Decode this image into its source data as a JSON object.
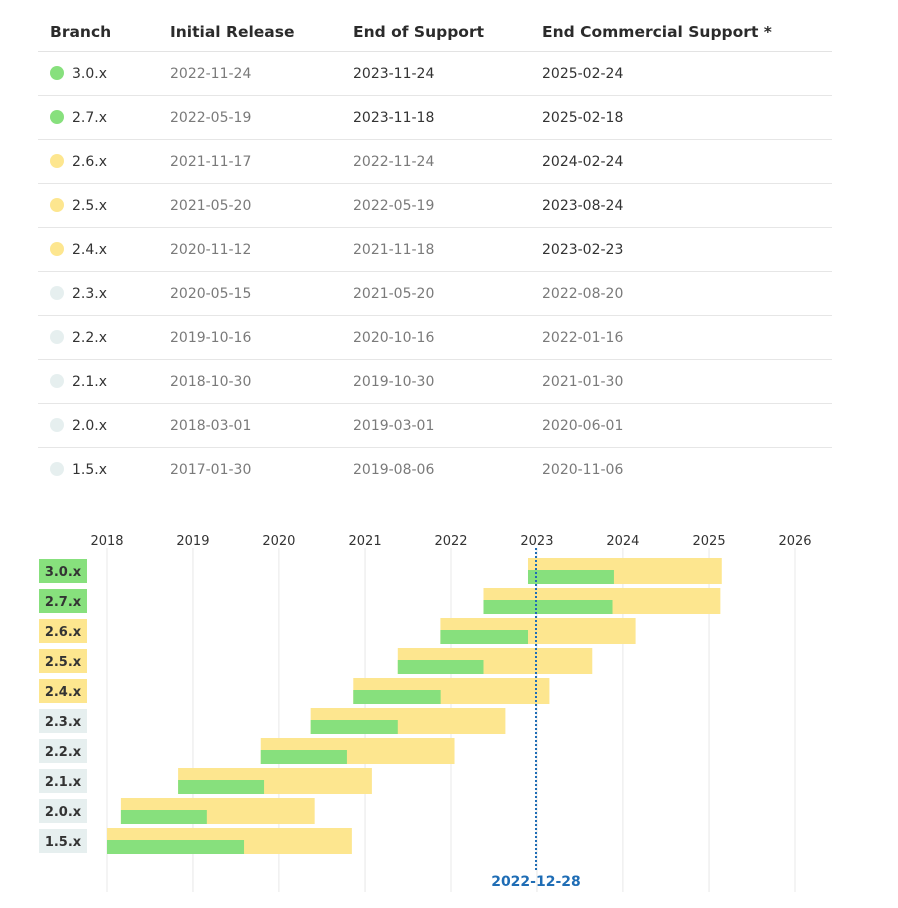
{
  "colors": {
    "supported": "#87e07d",
    "security": "#fde68f",
    "eol": "#e6efef",
    "now_line": "#1f6db5",
    "grid": "#e8e8e8"
  },
  "table": {
    "headers": [
      "Branch",
      "Initial Release",
      "End of Support",
      "End Commercial Support *"
    ],
    "rows": [
      {
        "branch": "3.0.x",
        "status": "supported",
        "initial": "2022-11-24",
        "eos": "2023-11-24",
        "ecs": "2025-02-24"
      },
      {
        "branch": "2.7.x",
        "status": "supported",
        "initial": "2022-05-19",
        "eos": "2023-11-18",
        "ecs": "2025-02-18"
      },
      {
        "branch": "2.6.x",
        "status": "security",
        "initial": "2021-11-17",
        "eos": "2022-11-24",
        "ecs": "2024-02-24"
      },
      {
        "branch": "2.5.x",
        "status": "security",
        "initial": "2021-05-20",
        "eos": "2022-05-19",
        "ecs": "2023-08-24"
      },
      {
        "branch": "2.4.x",
        "status": "security",
        "initial": "2020-11-12",
        "eos": "2021-11-18",
        "ecs": "2023-02-23"
      },
      {
        "branch": "2.3.x",
        "status": "eol",
        "initial": "2020-05-15",
        "eos": "2021-05-20",
        "ecs": "2022-08-20"
      },
      {
        "branch": "2.2.x",
        "status": "eol",
        "initial": "2019-10-16",
        "eos": "2020-10-16",
        "ecs": "2022-01-16"
      },
      {
        "branch": "2.1.x",
        "status": "eol",
        "initial": "2018-10-30",
        "eos": "2019-10-30",
        "ecs": "2021-01-30"
      },
      {
        "branch": "2.0.x",
        "status": "eol",
        "initial": "2018-03-01",
        "eos": "2019-03-01",
        "ecs": "2020-06-01"
      },
      {
        "branch": "1.5.x",
        "status": "eol",
        "initial": "2017-01-30",
        "eos": "2019-08-06",
        "ecs": "2020-11-06"
      }
    ]
  },
  "chart_data": {
    "type": "gantt",
    "x_ticks": [
      "2018",
      "2019",
      "2020",
      "2021",
      "2022",
      "2023",
      "2024",
      "2025",
      "2026"
    ],
    "xlim": [
      "2018-01-01",
      "2026-01-01"
    ],
    "grid": true,
    "now_label": "2022-12-28",
    "now_date": "2022-12-28",
    "rows": [
      {
        "branch": "3.0.x",
        "status": "supported",
        "start": "2022-11-24",
        "support_end": "2023-11-24",
        "commercial_end": "2025-02-24"
      },
      {
        "branch": "2.7.x",
        "status": "supported",
        "start": "2022-05-19",
        "support_end": "2023-11-18",
        "commercial_end": "2025-02-18"
      },
      {
        "branch": "2.6.x",
        "status": "security",
        "start": "2021-11-17",
        "support_end": "2022-11-24",
        "commercial_end": "2024-02-24"
      },
      {
        "branch": "2.5.x",
        "status": "security",
        "start": "2021-05-20",
        "support_end": "2022-05-19",
        "commercial_end": "2023-08-24"
      },
      {
        "branch": "2.4.x",
        "status": "security",
        "start": "2020-11-12",
        "support_end": "2021-11-18",
        "commercial_end": "2023-02-23"
      },
      {
        "branch": "2.3.x",
        "status": "eol",
        "start": "2020-05-15",
        "support_end": "2021-05-20",
        "commercial_end": "2022-08-20"
      },
      {
        "branch": "2.2.x",
        "status": "eol",
        "start": "2019-10-16",
        "support_end": "2020-10-16",
        "commercial_end": "2022-01-16"
      },
      {
        "branch": "2.1.x",
        "status": "eol",
        "start": "2018-10-30",
        "support_end": "2019-10-30",
        "commercial_end": "2021-01-30"
      },
      {
        "branch": "2.0.x",
        "status": "eol",
        "start": "2018-03-01",
        "support_end": "2019-03-01",
        "commercial_end": "2020-06-01"
      },
      {
        "branch": "1.5.x",
        "status": "eol",
        "start": "2018-01-01",
        "support_end": "2019-08-06",
        "commercial_end": "2020-11-06"
      }
    ]
  }
}
